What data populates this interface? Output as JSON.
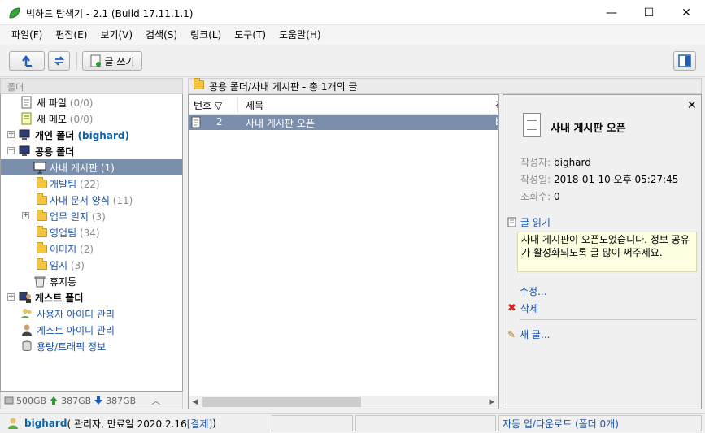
{
  "window": {
    "title": "빅하드 탐색기 - 2.1 (Build 17.11.1.1)",
    "minimize": "—",
    "maximize": "☐",
    "close": "✕"
  },
  "menu": [
    "파일(F)",
    "편집(E)",
    "보기(V)",
    "검색(S)",
    "링크(L)",
    "도구(T)",
    "도움말(H)"
  ],
  "toolbar": {
    "write_label": "글 쓰기"
  },
  "tree": {
    "header": "폴더",
    "items": [
      {
        "label": "새 파일",
        "count": "(0/0)"
      },
      {
        "label": "새 메모",
        "count": "(0/0)"
      },
      {
        "label": "개인 폴더",
        "extra": "(bighard)"
      },
      {
        "label": "공용 폴더"
      },
      {
        "label": "사내 게시판",
        "count": "(1)"
      },
      {
        "label": "개발팀",
        "count": "(22)"
      },
      {
        "label": "사내 문서 양식",
        "count": "(11)"
      },
      {
        "label": "업무 일지",
        "count": "(3)"
      },
      {
        "label": "영업팀",
        "count": "(34)"
      },
      {
        "label": "이미지",
        "count": "(2)"
      },
      {
        "label": "임시",
        "count": "(3)"
      },
      {
        "label": "휴지통"
      },
      {
        "label": "게스트 폴더"
      },
      {
        "label": "사용자 아이디 관리"
      },
      {
        "label": "게스트 아이디 관리"
      },
      {
        "label": "용량/트래픽 정보"
      }
    ]
  },
  "storage": {
    "total": "500GB",
    "used": "387GB",
    "free": "387GB"
  },
  "path": "공용 폴더/사내 게시판 - 총 1개의 글",
  "list": {
    "columns": [
      "번호 ▽",
      "제목",
      "작"
    ],
    "rows": [
      {
        "num": "2",
        "title": "사내 게시판 오픈",
        "author": "b"
      }
    ]
  },
  "detail": {
    "title": "사내 게시판 오픈",
    "author_key": "작성자:",
    "author": "bighard",
    "date_key": "작성일:",
    "date": "2018-01-10 오후 05:27:45",
    "views_key": "조회수:",
    "views": "0",
    "read_label": "글 읽기",
    "content": "사내 게시판이 오픈도었습니다. 정보 공유가 활성화되도록 글 많이 써주세요.",
    "edit_label": "수정...",
    "delete_label": "삭제",
    "new_label": "새 글..."
  },
  "status": {
    "user": "bighard",
    "info": "( 관리자, 만료일 2020.2.16 ",
    "pay": "[결제]",
    "info_end": " )",
    "transfer": "자동 업/다운로드 (폴더 0개)"
  }
}
